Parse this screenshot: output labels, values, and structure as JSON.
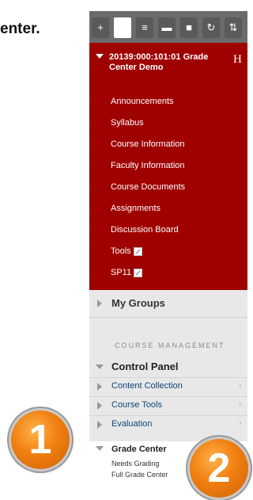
{
  "heading_fragment": "enter.",
  "toolbar": {
    "buttons": [
      {
        "icon": "plus-icon",
        "glyph": "+"
      },
      {
        "icon": "blank-selected-button",
        "glyph": ""
      },
      {
        "icon": "list-icon",
        "glyph": "≡"
      },
      {
        "icon": "folder-icon",
        "glyph": "▬"
      },
      {
        "icon": "window-icon",
        "glyph": "■"
      },
      {
        "icon": "refresh-icon",
        "glyph": "↻"
      },
      {
        "icon": "sort-icon",
        "glyph": "⇅"
      }
    ]
  },
  "course": {
    "title": "20139:000:101:01 Grade Center Demo",
    "header_icon_glyph": "H",
    "links": [
      "Announcements",
      "Syllabus",
      "Course Information",
      "Faculty Information",
      "Course Documents",
      "Assignments",
      "Discussion Board",
      "Tools",
      "SP11"
    ]
  },
  "my_groups_label": "My Groups",
  "course_management_label": "COURSE MANAGEMENT",
  "control_panel": {
    "label": "Control Panel",
    "items": [
      "Content Collection",
      "Course Tools",
      "Evaluation"
    ],
    "chevron": "›"
  },
  "grade_center": {
    "label": "Grade Center",
    "sub_items": [
      "Needs Grading",
      "Full Grade Center"
    ]
  },
  "badges": [
    "1",
    "2"
  ],
  "colors": {
    "course_red": "#9f0000",
    "toolbar_gray": "#6b6b6b",
    "badge_orange": "#f07f10",
    "link_blue": "#0c447a"
  }
}
